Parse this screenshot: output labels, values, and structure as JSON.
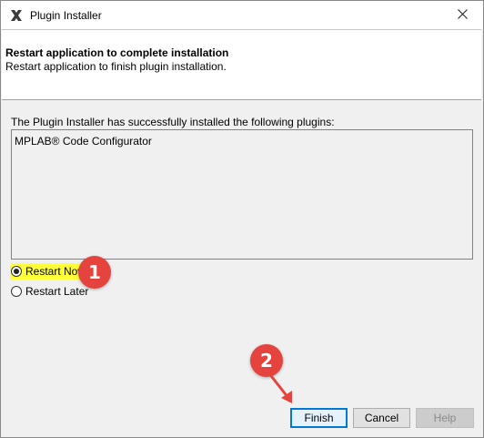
{
  "window": {
    "title": "Plugin Installer",
    "close_symbol": "✕",
    "icon": "plugin-installer-icon"
  },
  "header": {
    "title": "Restart application to complete installation",
    "subtitle": "Restart application to finish plugin installation."
  },
  "content": {
    "info_label": "The Plugin Installer has successfully installed the following plugins:",
    "plugins": [
      "MPLAB® Code Configurator"
    ]
  },
  "options": {
    "restart_now_label": "Restart Now",
    "restart_later_label": "Restart Later",
    "selected": "restart_now"
  },
  "annotations": {
    "badge1": "1",
    "badge2": "2",
    "badge_color": "#e5433d",
    "highlight_color": "#ffff3a"
  },
  "buttons": {
    "finish": "Finish",
    "cancel": "Cancel",
    "help": "Help"
  }
}
